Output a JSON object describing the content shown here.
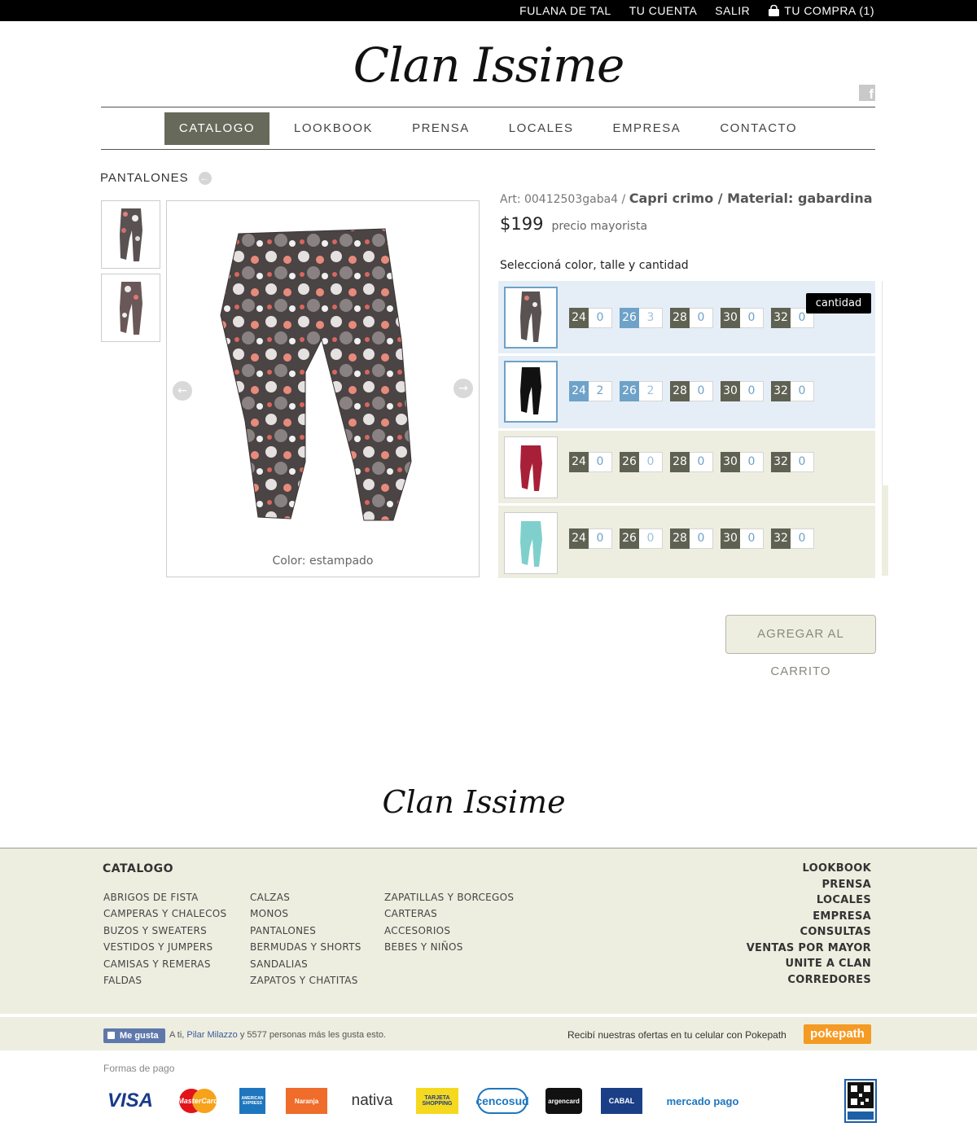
{
  "topbar": {
    "user": "FULANA DE TAL",
    "account": "TU CUENTA",
    "logout": "SALIR",
    "cart": "TU COMPRA (1)"
  },
  "brand": "Clan Issime",
  "nav": [
    "CATALOGO",
    "LOOKBOOK",
    "PRENSA",
    "LOCALES",
    "EMPRESA",
    "CONTACTO"
  ],
  "section": "PANTALONES",
  "product": {
    "art_label": "Art: 00412503gaba4 /",
    "name": "Capri crimo / Material: gabardina",
    "price": "$199",
    "price_note": "precio mayorista",
    "select_label": "Seleccioná color, talle y cantidad",
    "color_caption": "Color: estampado",
    "tooltip": "cantidad",
    "add_to_cart": "AGREGAR AL CARRITO"
  },
  "variants": [
    {
      "color": "estampado",
      "sizes": [
        {
          "n": "24",
          "q": "0"
        },
        {
          "n": "26",
          "q": "3",
          "hl": true
        },
        {
          "n": "28",
          "q": "0"
        },
        {
          "n": "30",
          "q": "0"
        },
        {
          "n": "32",
          "q": "0"
        }
      ]
    },
    {
      "color": "negro",
      "sizes": [
        {
          "n": "24",
          "q": "2",
          "hl": true
        },
        {
          "n": "26",
          "q": "2",
          "hl": true
        },
        {
          "n": "28",
          "q": "0"
        },
        {
          "n": "30",
          "q": "0"
        },
        {
          "n": "32",
          "q": "0"
        }
      ]
    },
    {
      "color": "bordo",
      "sizes": [
        {
          "n": "24",
          "q": "0"
        },
        {
          "n": "26",
          "q": "0"
        },
        {
          "n": "28",
          "q": "0"
        },
        {
          "n": "30",
          "q": "0"
        },
        {
          "n": "32",
          "q": "0"
        }
      ]
    },
    {
      "color": "turquesa",
      "sizes": [
        {
          "n": "24",
          "q": "0"
        },
        {
          "n": "26",
          "q": "0"
        },
        {
          "n": "28",
          "q": "0"
        },
        {
          "n": "30",
          "q": "0"
        },
        {
          "n": "32",
          "q": "0"
        }
      ]
    }
  ],
  "footer": {
    "catalog_title": "CATALOGO",
    "col1": [
      "ABRIGOS DE FISTA",
      "CAMPERAS Y CHALECOS",
      "BUZOS Y SWEATERS",
      "VESTIDOS Y JUMPERS",
      "CAMISAS Y REMERAS",
      "FALDAS"
    ],
    "col2": [
      "CALZAS",
      "MONOS",
      "PANTALONES",
      "BERMUDAS Y SHORTS",
      "SANDALIAS",
      "ZAPATOS Y CHATITAS"
    ],
    "col3": [
      "ZAPATILLAS Y BORCEGOS",
      "CARTERAS",
      "ACCESORIOS",
      "BEBES Y NIÑOS"
    ],
    "right": [
      "LOOKBOOK",
      "PRENSA",
      "LOCALES",
      "EMPRESA",
      "CONSULTAS",
      "VENTAS POR MAYOR",
      "UNITE A CLAN",
      "CORREDORES"
    ]
  },
  "social": {
    "like": "Me gusta",
    "like_pre": "A ti,",
    "like_name": "Pilar Milazzo",
    "like_post": "y 5577 personas más les gusta esto.",
    "poke_text": "Recibí nuestras ofertas en tu celular con Pokepath",
    "poke_logo": "pokepath"
  },
  "payments": {
    "title": "Formas de pago",
    "items": [
      "VISA",
      "MasterCard",
      "AMERICAN EXPRESS",
      "Naranja",
      "nativa",
      "TARJETA SHOPPING",
      "cencosud",
      "argencard",
      "CABAL",
      "mercado pago"
    ]
  },
  "colors": {
    "accent": "#67695a",
    "blue": "#6ea2c8",
    "cream": "#edeee0"
  }
}
